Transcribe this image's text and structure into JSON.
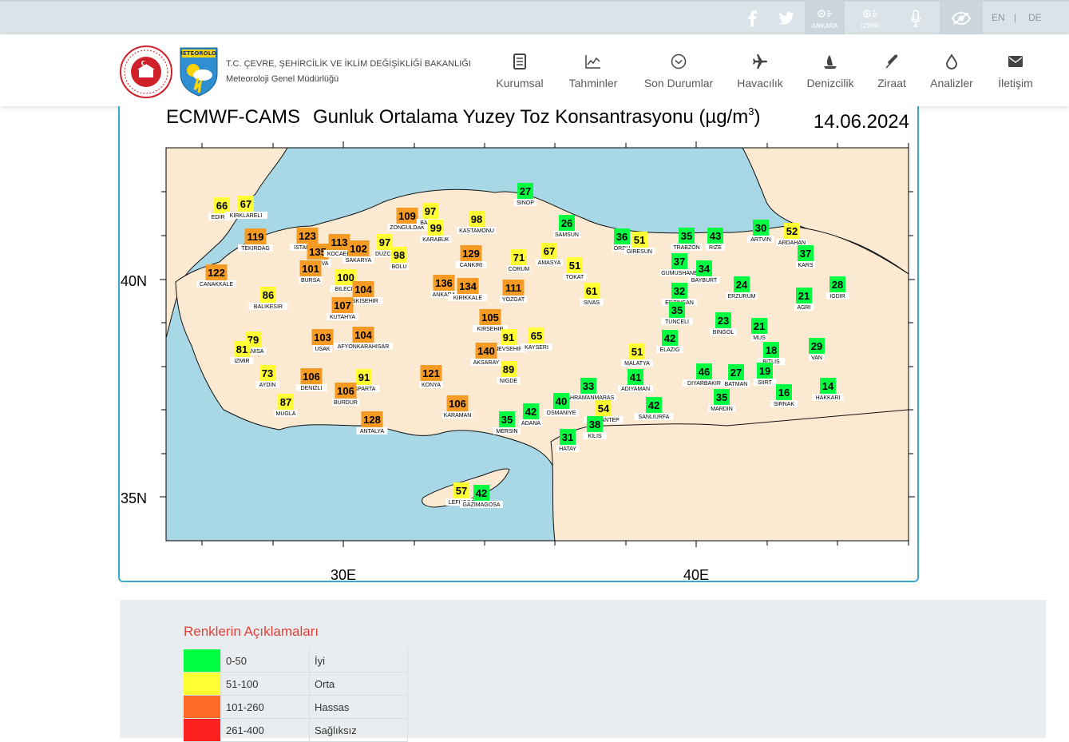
{
  "topbar": {
    "social": [
      {
        "icon": "facebook-icon"
      },
      {
        "icon": "twitter-icon"
      }
    ],
    "city_buttons": [
      {
        "label": "ANKARA",
        "icon": "radar-icon"
      },
      {
        "label": "İZMİR",
        "icon": "radar-icon"
      }
    ],
    "mic_icon": "microphone-icon",
    "eye_icon": "accessibility-eye-icon",
    "lang_en": "EN",
    "lang_sep": "|",
    "lang_de": "DE"
  },
  "header": {
    "ministry": "T.C. ÇEVRE, ŞEHİRCİLİK VE İKLİM DEĞİŞİKLİĞİ BAKANLIĞI",
    "directorate": "Meteoroloji Genel Müdürlüğü",
    "logo_text": "METEOROLOJİ",
    "nav": [
      {
        "label": "Kurumsal",
        "icon": "document-icon"
      },
      {
        "label": "Tahminler",
        "icon": "chart-icon"
      },
      {
        "label": "Son Durumlar",
        "icon": "chevron-circle-icon"
      },
      {
        "label": "Havacılık",
        "icon": "airplane-icon"
      },
      {
        "label": "Denizcilik",
        "icon": "sailboat-icon"
      },
      {
        "label": "Ziraat",
        "icon": "wheat-icon"
      },
      {
        "label": "Analizler",
        "icon": "drop-icon"
      },
      {
        "label": "İletişim",
        "icon": "envelope-icon"
      }
    ]
  },
  "map": {
    "model": "ECMWF-CAMS",
    "title": "Gunluk Ortalama Yuzey Toz Konsantrasyonu (µg/m",
    "title_sup": "3",
    "title_close": ")",
    "date": "14.06.2024",
    "lat_labels": [
      "40N",
      "35N"
    ],
    "lon_labels": [
      "30E",
      "40E"
    ],
    "colors": {
      "green": "#00ff40",
      "yellow": "#ffff33",
      "orange": "#f59a23",
      "land": "#fbe9d2",
      "sea": "#a8d8e6"
    },
    "stations": [
      {
        "n": "EDIRNE",
        "v": "66",
        "c": "yellow"
      },
      {
        "n": "KIRKLARELI",
        "v": "67",
        "c": "yellow"
      },
      {
        "n": "TEKIRDAG",
        "v": "119",
        "c": "orange"
      },
      {
        "n": "ISTANBUL",
        "v": "123",
        "c": "orange"
      },
      {
        "n": "YALOVA",
        "v": "135",
        "c": "orange"
      },
      {
        "n": "KOCAELI",
        "v": "113",
        "c": "orange"
      },
      {
        "n": "SAKARYA",
        "v": "102",
        "c": "orange"
      },
      {
        "n": "DUZCE",
        "v": "97",
        "c": "yellow"
      },
      {
        "n": "BOLU",
        "v": "98",
        "c": "yellow"
      },
      {
        "n": "ZONGULDAK",
        "v": "109",
        "c": "orange"
      },
      {
        "n": "BARTIN",
        "v": "97",
        "c": "yellow"
      },
      {
        "n": "KARABUK",
        "v": "99",
        "c": "yellow"
      },
      {
        "n": "KASTAMONU",
        "v": "98",
        "c": "yellow"
      },
      {
        "n": "SINOP",
        "v": "27",
        "c": "green"
      },
      {
        "n": "SAMSUN",
        "v": "26",
        "c": "green"
      },
      {
        "n": "ORDU",
        "v": "36",
        "c": "green"
      },
      {
        "n": "GIRESUN",
        "v": "51",
        "c": "yellow"
      },
      {
        "n": "TRABZON",
        "v": "35",
        "c": "green"
      },
      {
        "n": "RIZE",
        "v": "43",
        "c": "green"
      },
      {
        "n": "ARTVIN",
        "v": "30",
        "c": "green"
      },
      {
        "n": "ARDAHAN",
        "v": "52",
        "c": "yellow"
      },
      {
        "n": "KARS",
        "v": "37",
        "c": "green"
      },
      {
        "n": "IGDIR",
        "v": "28",
        "c": "green"
      },
      {
        "n": "CANAKKALE",
        "v": "122",
        "c": "orange"
      },
      {
        "n": "BURSA",
        "v": "101",
        "c": "orange"
      },
      {
        "n": "BILECIK",
        "v": "100",
        "c": "yellow"
      },
      {
        "n": "ESKISEHIR",
        "v": "104",
        "c": "orange"
      },
      {
        "n": "BALIKESIR",
        "v": "86",
        "c": "yellow"
      },
      {
        "n": "KUTAHYA",
        "v": "107",
        "c": "orange"
      },
      {
        "n": "CANKIRI",
        "v": "129",
        "c": "orange"
      },
      {
        "n": "CORUM",
        "v": "71",
        "c": "yellow"
      },
      {
        "n": "AMASYA",
        "v": "67",
        "c": "yellow"
      },
      {
        "n": "TOKAT",
        "v": "51",
        "c": "yellow"
      },
      {
        "n": "GUMUSHANE",
        "v": "37",
        "c": "green"
      },
      {
        "n": "BAYBURT",
        "v": "34",
        "c": "green"
      },
      {
        "n": "ERZURUM",
        "v": "24",
        "c": "green"
      },
      {
        "n": "AGRI",
        "v": "21",
        "c": "green"
      },
      {
        "n": "ANKARA",
        "v": "136",
        "c": "orange"
      },
      {
        "n": "KIRIKKALE",
        "v": "134",
        "c": "orange"
      },
      {
        "n": "YOZGAT",
        "v": "111",
        "c": "orange"
      },
      {
        "n": "SIVAS",
        "v": "61",
        "c": "yellow"
      },
      {
        "n": "ERZINCAN",
        "v": "32",
        "c": "green"
      },
      {
        "n": "TUNCELI",
        "v": "35",
        "c": "green"
      },
      {
        "n": "BINGOL",
        "v": "23",
        "c": "green"
      },
      {
        "n": "MUS",
        "v": "21",
        "c": "green"
      },
      {
        "n": "MANISA",
        "v": "79",
        "c": "yellow"
      },
      {
        "n": "IZMIR",
        "v": "81",
        "c": "yellow"
      },
      {
        "n": "USAK",
        "v": "103",
        "c": "orange"
      },
      {
        "n": "AFYONKARAHISAR",
        "v": "104",
        "c": "orange"
      },
      {
        "n": "KIRSEHIR",
        "v": "105",
        "c": "orange"
      },
      {
        "n": "NEVSEHIR",
        "v": "91",
        "c": "yellow"
      },
      {
        "n": "KAYSERI",
        "v": "65",
        "c": "yellow"
      },
      {
        "n": "AKSARAY",
        "v": "140",
        "c": "orange"
      },
      {
        "n": "MALATYA",
        "v": "51",
        "c": "yellow"
      },
      {
        "n": "ELAZIG",
        "v": "42",
        "c": "green"
      },
      {
        "n": "BITLIS",
        "v": "18",
        "c": "green"
      },
      {
        "n": "VAN",
        "v": "29",
        "c": "green"
      },
      {
        "n": "AYDIN",
        "v": "73",
        "c": "yellow"
      },
      {
        "n": "DENIZLI",
        "v": "106",
        "c": "orange"
      },
      {
        "n": "ISPARTA",
        "v": "91",
        "c": "yellow"
      },
      {
        "n": "BURDUR",
        "v": "106",
        "c": "orange"
      },
      {
        "n": "KONYA",
        "v": "121",
        "c": "orange"
      },
      {
        "n": "NIGDE",
        "v": "89",
        "c": "yellow"
      },
      {
        "n": "ADIYAMAN",
        "v": "41",
        "c": "green"
      },
      {
        "n": "DIYARBAKIR",
        "v": "46",
        "c": "green"
      },
      {
        "n": "BATMAN",
        "v": "27",
        "c": "green"
      },
      {
        "n": "SIIRT",
        "v": "19",
        "c": "green"
      },
      {
        "n": "MUGLA",
        "v": "87",
        "c": "yellow"
      },
      {
        "n": "ANTALYA",
        "v": "128",
        "c": "orange"
      },
      {
        "n": "KARAMAN",
        "v": "106",
        "c": "orange"
      },
      {
        "n": "KAHRAMANMARAS",
        "v": "33",
        "c": "green"
      },
      {
        "n": "OSMANIYE",
        "v": "40",
        "c": "green"
      },
      {
        "n": "GAZIANTEP",
        "v": "54",
        "c": "yellow"
      },
      {
        "n": "KILIS",
        "v": "38",
        "c": "green"
      },
      {
        "n": "SANLIURFA",
        "v": "42",
        "c": "green"
      },
      {
        "n": "MARDIN",
        "v": "35",
        "c": "green"
      },
      {
        "n": "SIRNAK",
        "v": "16",
        "c": "green"
      },
      {
        "n": "HAKKARI",
        "v": "14",
        "c": "green"
      },
      {
        "n": "MERSIN",
        "v": "35",
        "c": "green"
      },
      {
        "n": "ADANA",
        "v": "42",
        "c": "green"
      },
      {
        "n": "HATAY",
        "v": "31",
        "c": "green"
      },
      {
        "n": "LEFKOSA",
        "v": "57",
        "c": "yellow"
      },
      {
        "n": "GAZIMAGOSA",
        "v": "42",
        "c": "green"
      }
    ]
  },
  "legend": {
    "title": "Renklerin Açıklamaları",
    "rows": [
      {
        "color": "#00ff40",
        "range": "0-50",
        "label": "İyi"
      },
      {
        "color": "#ffff33",
        "range": "51-100",
        "label": "Orta"
      },
      {
        "color": "#ff6a26",
        "range": "101-260",
        "label": "Hassas"
      },
      {
        "color": "#ff2020",
        "range": "261-400",
        "label": "Sağlıksız"
      }
    ]
  }
}
